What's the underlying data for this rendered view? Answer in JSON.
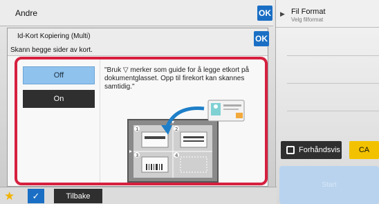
{
  "header": {
    "title": "Andre",
    "ok_label": "OK"
  },
  "dialog": {
    "title": "Id-Kort Kopiering (Multi)",
    "ok_label": "OK",
    "subtitle": "Skann begge sider av kort.",
    "options": {
      "off_label": "Off",
      "on_label": "On",
      "selected": "Off"
    },
    "instruction": "\"Bruk ▽ merker som guide for å legge etkort på dokumentglasset. Opp til firekort kan skannes samtidig.\""
  },
  "right_panel": {
    "file_format_title": "Fil Format",
    "file_format_sub": "Velg filformat",
    "preview_label": "Forhåndsvis",
    "ca_label": "CA",
    "start_label": "Start"
  },
  "bottom_bar": {
    "back_label": "Tilbake"
  },
  "icons": [
    "play-icon",
    "preview-icon",
    "star-icon",
    "check-icon"
  ],
  "colors": {
    "accent": "#1a6fc4",
    "highlight": "#d6203f",
    "ca": "#f2c200",
    "selected_option": "#8fc3ee"
  }
}
